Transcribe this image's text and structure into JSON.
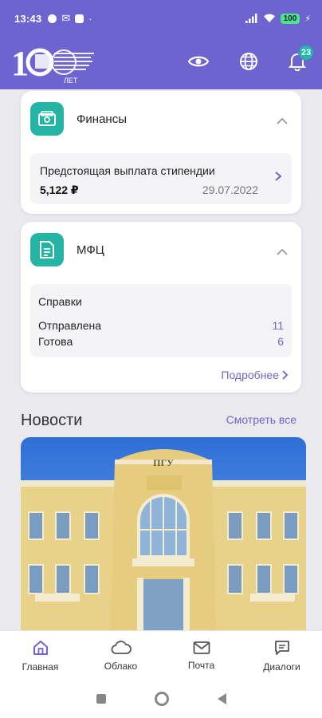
{
  "statusbar": {
    "time": "13:43",
    "battery": "100"
  },
  "header": {
    "logo_number": "100",
    "logo_suffix": "ЛЕТ",
    "notifications_count": "23",
    "colors": {
      "primary": "#6e64d0",
      "accent": "#25b3a3"
    }
  },
  "finance_card": {
    "title": "Финансы",
    "icon": "wallet-icon",
    "item": {
      "label": "Предстоящая выплата стипендии",
      "amount": "5,122 ₽",
      "date": "29.07.2022"
    }
  },
  "mfc_card": {
    "title": "МФЦ",
    "icon": "document-icon",
    "section_title": "Справки",
    "rows": [
      {
        "label": "Отправлена",
        "value": "11"
      },
      {
        "label": "Готова",
        "value": "6"
      }
    ],
    "more_link": "Подробнее"
  },
  "news": {
    "title": "Новости",
    "see_all": "Смотреть все",
    "building_sign": "ПГУ"
  },
  "bottom_nav": [
    {
      "label": "Главная",
      "icon": "home-icon",
      "active": true
    },
    {
      "label": "Облако",
      "icon": "cloud-icon",
      "active": false
    },
    {
      "label": "Почта",
      "icon": "mail-icon",
      "active": false
    },
    {
      "label": "Диалоги",
      "icon": "chat-icon",
      "active": false
    }
  ]
}
